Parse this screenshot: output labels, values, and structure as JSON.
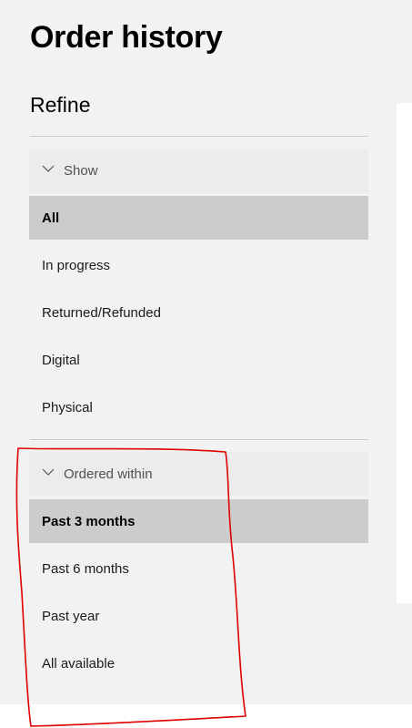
{
  "page": {
    "title": "Order history"
  },
  "refine": {
    "title": "Refine"
  },
  "show": {
    "header": "Show",
    "icon": "chevron-down-icon",
    "selected": "All",
    "options": [
      {
        "label": "All",
        "selected": true
      },
      {
        "label": "In progress",
        "selected": false
      },
      {
        "label": "Returned/Refunded",
        "selected": false
      },
      {
        "label": "Digital",
        "selected": false
      },
      {
        "label": "Physical",
        "selected": false
      }
    ]
  },
  "ordered_within": {
    "header": "Ordered within",
    "icon": "chevron-down-icon",
    "selected": "Past 3 months",
    "options": [
      {
        "label": "Past 3 months",
        "selected": true
      },
      {
        "label": "Past 6 months",
        "selected": false
      },
      {
        "label": "Past year",
        "selected": false
      },
      {
        "label": "All available",
        "selected": false
      }
    ]
  },
  "colors": {
    "background": "#f2f2f2",
    "selected_row": "#cccccc",
    "annotation_outline": "#e00000"
  }
}
